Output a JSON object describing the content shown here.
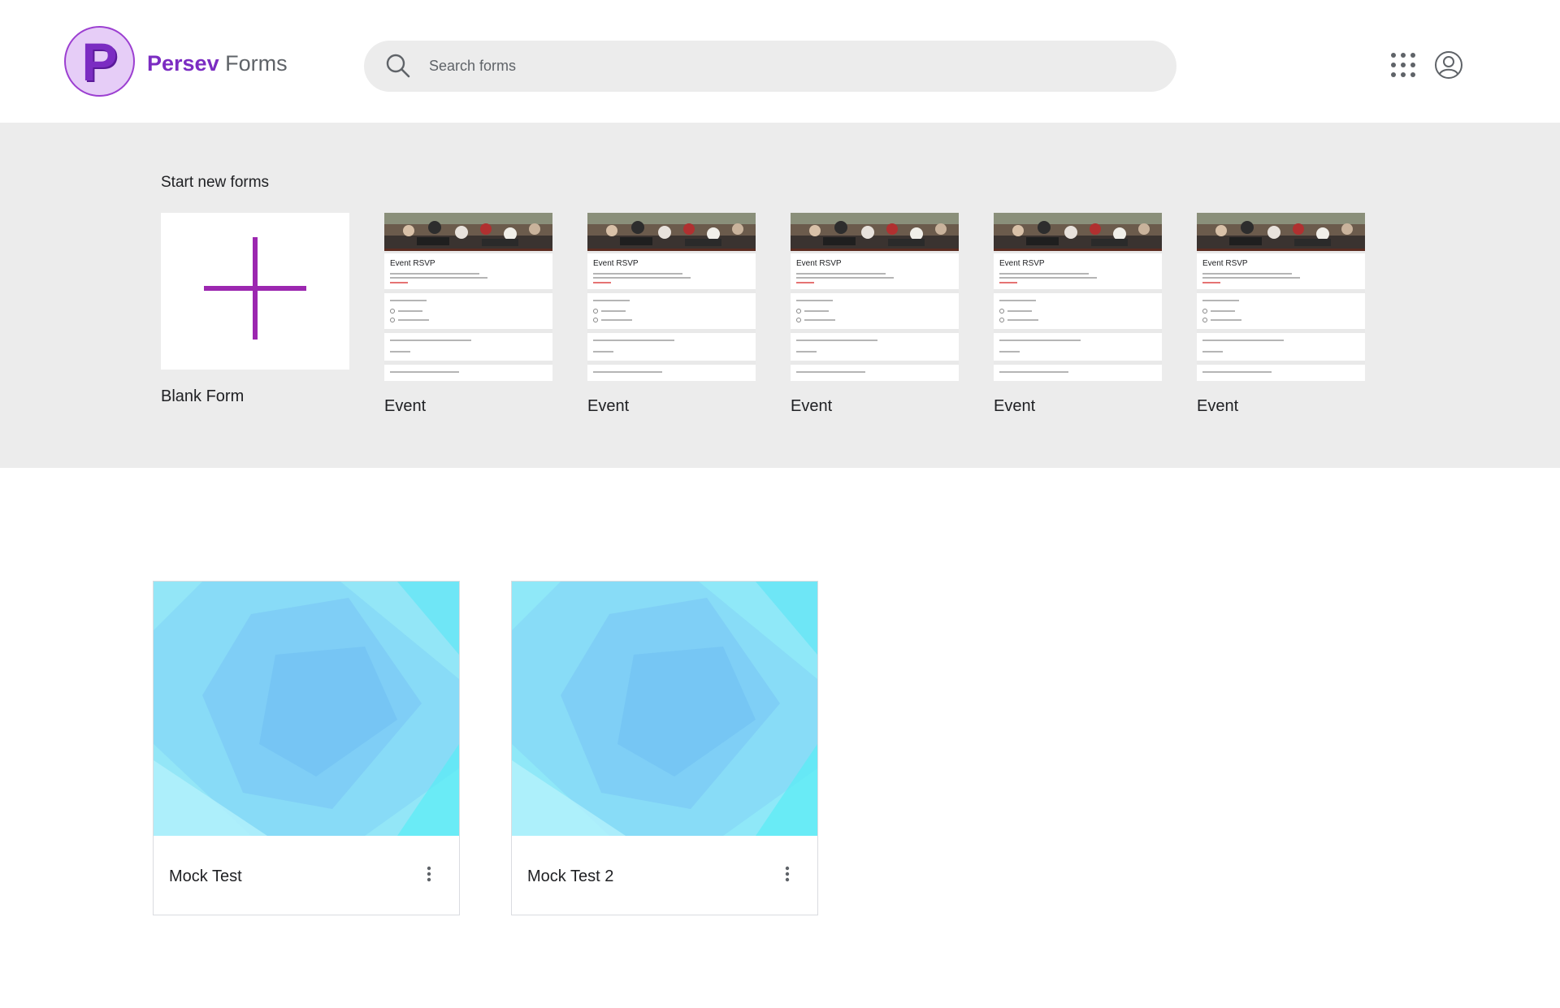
{
  "header": {
    "logo_letter": "P",
    "brand_name": "Persev",
    "brand_product": "Forms",
    "search": {
      "placeholder": "Search forms",
      "value": ""
    },
    "apps_icon": "apps-grid-icon",
    "account_icon": "account-circle-icon"
  },
  "templates": {
    "heading": "Start new forms",
    "blank": {
      "label": "Blank Form",
      "icon": "plus-icon"
    },
    "items": [
      {
        "label": "Event",
        "preview_title": "Event RSVP"
      },
      {
        "label": "Event",
        "preview_title": "Event RSVP"
      },
      {
        "label": "Event",
        "preview_title": "Event RSVP"
      },
      {
        "label": "Event",
        "preview_title": "Event RSVP"
      },
      {
        "label": "Event",
        "preview_title": "Event RSVP"
      }
    ]
  },
  "recent_forms": [
    {
      "title": "Mock Test",
      "menu_icon": "more-vert-icon"
    },
    {
      "title": "Mock Test 2",
      "menu_icon": "more-vert-icon"
    }
  ],
  "colors": {
    "brand_purple": "#7b2cc2",
    "plus_purple": "#9c27b0",
    "band_gray": "#ececec",
    "thumb_cyan": "#7fe3f7"
  }
}
